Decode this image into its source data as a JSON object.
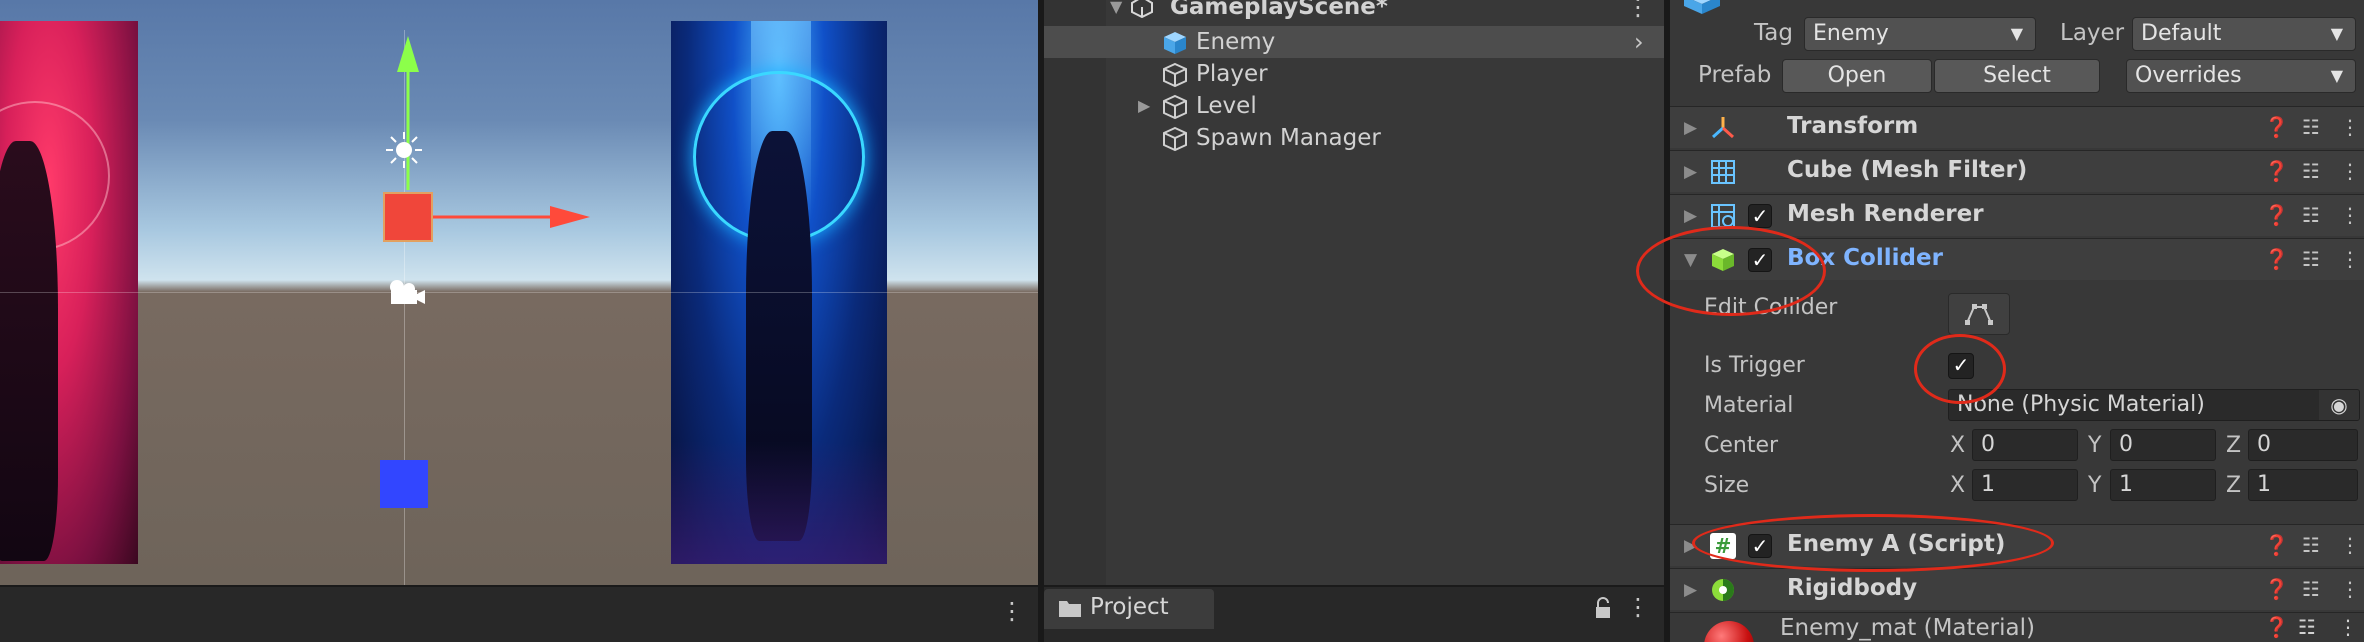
{
  "hierarchy": {
    "scene_name": "GameplayScene*",
    "items": [
      {
        "label": "Enemy"
      },
      {
        "label": "Player"
      },
      {
        "label": "Level"
      },
      {
        "label": "Spawn Manager"
      }
    ]
  },
  "project": {
    "tab_label": "Project"
  },
  "inspector": {
    "tag_label": "Tag",
    "tag_value": "Enemy",
    "layer_label": "Layer",
    "layer_value": "Default",
    "prefab_label": "Prefab",
    "open_label": "Open",
    "select_label": "Select",
    "overrides_label": "Overrides",
    "components": [
      {
        "title": "Transform"
      },
      {
        "title": "Cube (Mesh Filter)"
      },
      {
        "title": "Mesh Renderer"
      },
      {
        "title": "Box Collider"
      },
      {
        "title": "Enemy A (Script)"
      },
      {
        "title": "Rigidbody"
      },
      {
        "title": "Enemy_mat (Material)"
      }
    ],
    "box_collider": {
      "edit_collider_label": "Edit Collider",
      "is_trigger_label": "Is Trigger",
      "material_label": "Material",
      "material_value": "None (Physic Material)",
      "center_label": "Center",
      "size_label": "Size",
      "axis_x": "X",
      "axis_y": "Y",
      "axis_z": "Z",
      "center": {
        "x": "0",
        "y": "0",
        "z": "0"
      },
      "size": {
        "x": "1",
        "y": "1",
        "z": "1"
      },
      "is_trigger": true
    }
  },
  "colors": {
    "accent_blue": "#7fb4ff",
    "annotation_red": "#e02a1a",
    "panel_bg": "#383838",
    "header_bg": "#3e3e3e"
  },
  "icons": [
    "unity-scene-icon",
    "cube-icon",
    "transform-icon",
    "mesh-filter-icon",
    "mesh-renderer-icon",
    "box-collider-icon",
    "script-icon",
    "rigidbody-icon",
    "help-icon",
    "presets-icon",
    "kebab-menu-icon",
    "edit-collider-icon",
    "object-picker-icon",
    "folder-icon",
    "lock-icon",
    "sun-icon",
    "camera-icon"
  ]
}
